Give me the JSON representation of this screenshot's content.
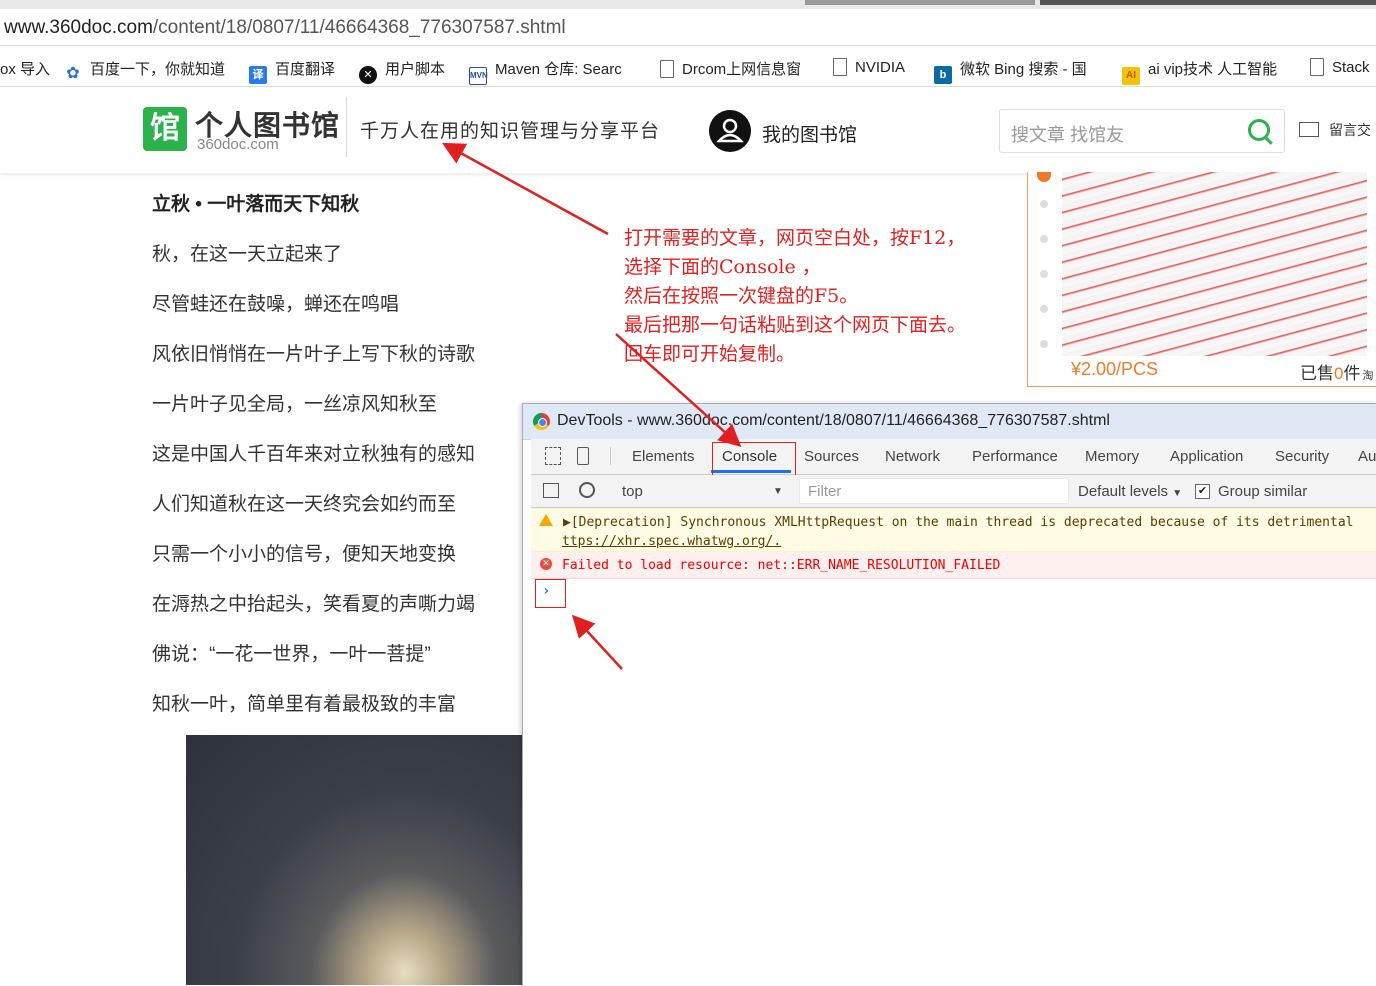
{
  "browser": {
    "url_host": "www.360doc.com",
    "url_path": "/content/18/0807/11/46664368_776307587.shtml"
  },
  "bookmarks": [
    {
      "label": "ox 导入",
      "icon": "none"
    },
    {
      "label": "百度一下，你就知道",
      "icon": "baidu-paw-icon"
    },
    {
      "label": "百度翻译",
      "icon": "translate-icon"
    },
    {
      "label": "用户脚本",
      "icon": "userscript-icon"
    },
    {
      "label": "Maven 仓库: Searc",
      "icon": "maven-icon"
    },
    {
      "label": "Drcom上网信息窗",
      "icon": "page-icon"
    },
    {
      "label": "NVIDIA",
      "icon": "page-icon"
    },
    {
      "label": "微软 Bing 搜索 - 国",
      "icon": "bing-icon"
    },
    {
      "label": "ai vip技术 人工智能",
      "icon": "ai-icon"
    },
    {
      "label": "Stack",
      "icon": "page-icon"
    }
  ],
  "site": {
    "logo_icon_char": "馆",
    "logo_name": "个人图书馆",
    "logo_domain": "360doc.com",
    "slogan": "千万人在用的知识管理与分享平台",
    "my_library": "我的图书馆",
    "search_placeholder": "搜文章 找馆友",
    "messages": "留言交"
  },
  "article": {
    "heading": "立秋 • 一叶落而天下知秋",
    "lines": [
      "秋，在这一天立起来了",
      "尽管蛙还在鼓噪，蝉还在鸣唱",
      "风依旧悄悄在一片叶子上写下秋的诗歌",
      "一片叶子见全局，一丝凉风知秋至",
      "这是中国人千百年来对立秋独有的感知",
      "人们知道秋在这一天终究会如约而至",
      "只需一个小小的信号，便知天地变换",
      "在溽热之中抬起头，笑看夏的声嘶力竭",
      "佛说：“一花一世界，一叶一菩提”",
      "知秋一叶，简单里有着最极致的丰富"
    ]
  },
  "ad": {
    "price": "¥2.00/PCS",
    "sold_prefix": "已售",
    "sold_count": "0",
    "sold_suffix": "件",
    "corner": "淘"
  },
  "annotation": {
    "lines": [
      "打开需要的文章，网页空白处，按F12，",
      "选择下面的Console ，",
      "然后在按照一次键盘的F5。",
      "最后把那一句话粘贴到这个网页下面去。",
      "回车即可开始复制。"
    ],
    "color": "#e02020"
  },
  "devtools": {
    "title": "DevTools - www.360doc.com/content/18/0807/11/46664368_776307587.shtml",
    "tabs": [
      "Elements",
      "Console",
      "Sources",
      "Network",
      "Performance",
      "Memory",
      "Application",
      "Security",
      "Au"
    ],
    "active_tab": "Console",
    "context": "top",
    "filter_placeholder": "Filter",
    "levels": "Default levels",
    "group_similar": "Group similar",
    "group_similar_checked": true,
    "messages": {
      "warning_line1": "▶[Deprecation] Synchronous XMLHttpRequest on the main thread is deprecated because of its detrimental",
      "warning_link": "ttps://xhr.spec.whatwg.org/",
      "warning_tail": ".",
      "error_line": "Failed to load resource: net::ERR_NAME_RESOLUTION_FAILED"
    },
    "prompt": "›"
  }
}
